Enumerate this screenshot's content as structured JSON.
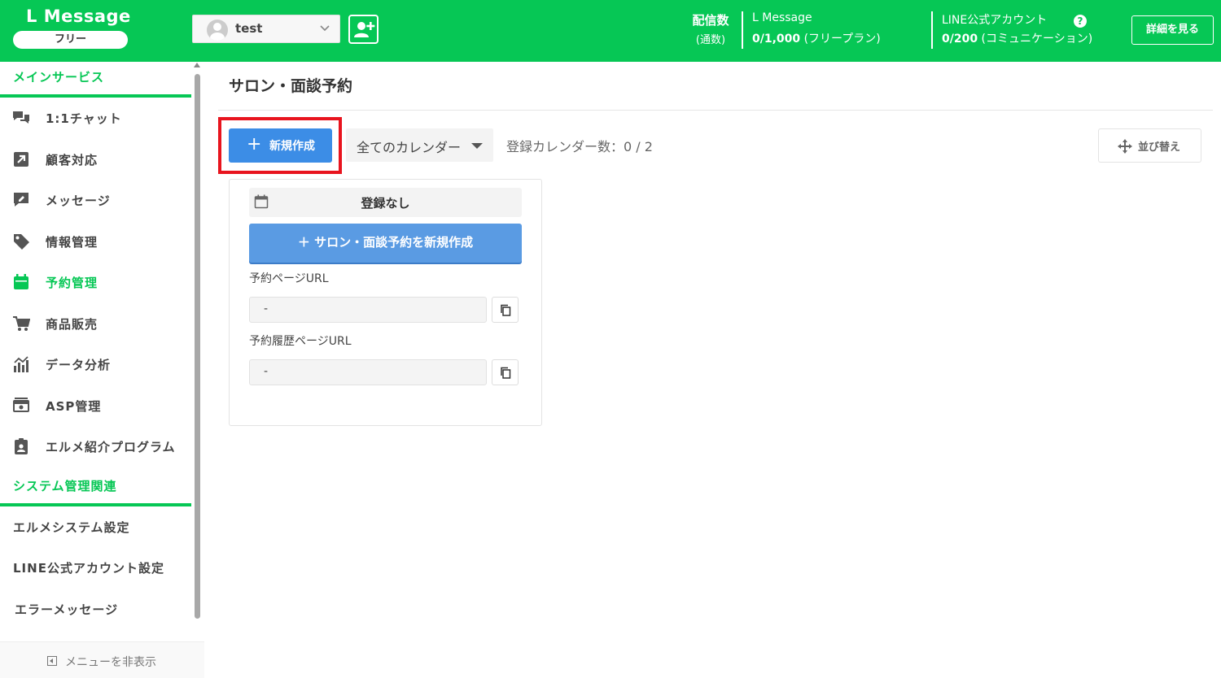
{
  "header": {
    "logo_title": "L Message",
    "plan_badge": "フリー",
    "account_name": "test",
    "stat_label": "配信数",
    "stat_sub": "(通数)",
    "lmessage_name": "L Message",
    "lmessage_count": "0/1,000",
    "lmessage_plan": "(フリープラン)",
    "line_name": "LINE公式アカウント",
    "line_count": "0/200",
    "line_plan": "(コミュニケーション)",
    "help_glyph": "?",
    "detail_label": "詳細を見る"
  },
  "sidebar": {
    "main_section": "メインサービス",
    "items": [
      {
        "label": "1:1チャット",
        "icon": "chat-icon"
      },
      {
        "label": "顧客対応",
        "icon": "external-link-icon"
      },
      {
        "label": "メッセージ",
        "icon": "message-edit-icon"
      },
      {
        "label": "情報管理",
        "icon": "tag-icon"
      },
      {
        "label": "予約管理",
        "icon": "calendar-icon",
        "active": true
      },
      {
        "label": "商品販売",
        "icon": "cart-icon"
      },
      {
        "label": "データ分析",
        "icon": "chart-icon"
      },
      {
        "label": "ASP管理",
        "icon": "asp-icon"
      },
      {
        "label": "エルメ紹介プログラム",
        "icon": "clipboard-user-icon"
      }
    ],
    "system_section": "システム管理関連",
    "system_items": [
      {
        "label": "エルメシステム設定"
      },
      {
        "label": "LINE公式アカウント設定"
      },
      {
        "label": "エラーメッセージ"
      }
    ],
    "hide_menu": "メニューを非表示"
  },
  "main": {
    "page_title": "サロン・面談予約",
    "new_button": "新規作成",
    "calendar_filter": "全てのカレンダー",
    "count_text": "登録カレンダー数：0 / 2",
    "sort_button": "並び替え",
    "card": {
      "title": "登録なし",
      "create_button": "＋ サロン・面談予約を新規作成",
      "booking_url_label": "予約ページURL",
      "booking_url_value": "-",
      "history_url_label": "予約履歴ページURL",
      "history_url_value": "-"
    }
  },
  "colors": {
    "brand": "#06c755",
    "primary_button": "#3c8de6",
    "highlight": "#e8141e"
  }
}
